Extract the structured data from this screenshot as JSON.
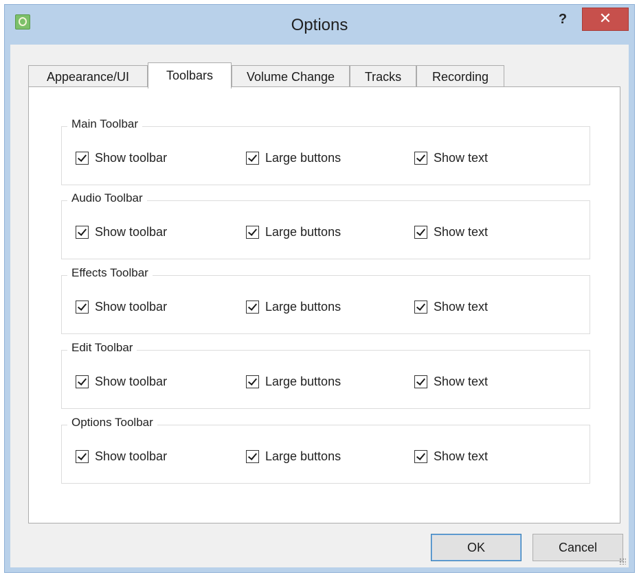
{
  "window": {
    "title": "Options",
    "help_label": "?",
    "close_label": "✕",
    "icon": "app-icon"
  },
  "tabs": [
    {
      "label": "Appearance/UI",
      "active": false
    },
    {
      "label": "Toolbars",
      "active": true
    },
    {
      "label": "Volume Change",
      "active": false
    },
    {
      "label": "Tracks",
      "active": false
    },
    {
      "label": "Recording",
      "active": false
    }
  ],
  "groups": [
    {
      "title": "Main Toolbar",
      "show_toolbar": "Show toolbar",
      "large_buttons": "Large buttons",
      "show_text": "Show text",
      "checked": [
        true,
        true,
        true
      ]
    },
    {
      "title": "Audio Toolbar",
      "show_toolbar": "Show toolbar",
      "large_buttons": "Large buttons",
      "show_text": "Show text",
      "checked": [
        true,
        true,
        true
      ]
    },
    {
      "title": "Effects Toolbar",
      "show_toolbar": "Show toolbar",
      "large_buttons": "Large buttons",
      "show_text": "Show text",
      "checked": [
        true,
        true,
        true
      ]
    },
    {
      "title": "Edit Toolbar",
      "show_toolbar": "Show toolbar",
      "large_buttons": "Large buttons",
      "show_text": "Show text",
      "checked": [
        true,
        true,
        true
      ]
    },
    {
      "title": "Options Toolbar",
      "show_toolbar": "Show toolbar",
      "large_buttons": "Large buttons",
      "show_text": "Show text",
      "checked": [
        true,
        true,
        true
      ]
    }
  ],
  "buttons": {
    "ok": "OK",
    "cancel": "Cancel"
  },
  "colors": {
    "title_bar": "#b9d1ea",
    "close_button": "#c7504c",
    "ok_button_border": "#3c7fb1"
  }
}
